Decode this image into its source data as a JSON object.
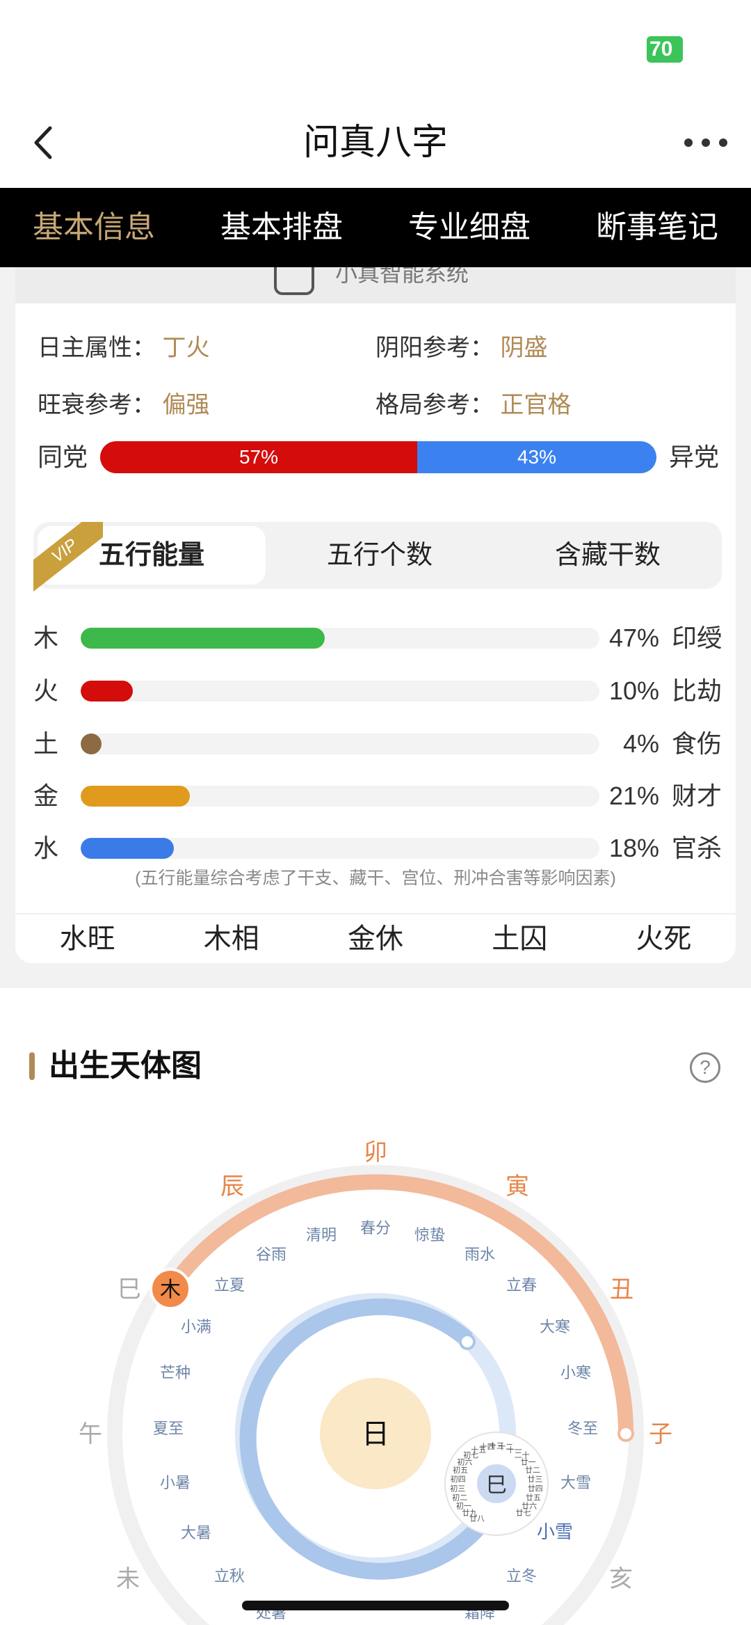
{
  "status": {
    "battery": "70"
  },
  "header": {
    "title": "问真八字"
  },
  "tabs": [
    "基本信息",
    "基本排盘",
    "专业细盘",
    "断事笔记"
  ],
  "strip_text": "小真智能系统",
  "info": {
    "day_master_label": "日主属性：",
    "day_master_value": "丁火",
    "yinyang_label": "阴阳参考：",
    "yinyang_value": "阴盛",
    "strength_label": "旺衰参考：",
    "strength_value": "偏强",
    "pattern_label": "格局参考：",
    "pattern_value": "正官格"
  },
  "party": {
    "left": "同党",
    "right": "异党",
    "same_pct": "57%",
    "diff_pct": "43%",
    "same": 57,
    "diff": 43,
    "same_color": "#d40c0c",
    "diff_color": "#3b82f0"
  },
  "segments": {
    "vip": "VIP",
    "items": [
      "五行能量",
      "五行个数",
      "含藏干数"
    ]
  },
  "elements": [
    {
      "name": "木",
      "pct": "47%",
      "value": 47,
      "god": "印绶",
      "color": "#3db84a"
    },
    {
      "name": "火",
      "pct": "10%",
      "value": 10,
      "god": "比劫",
      "color": "#d40c0c"
    },
    {
      "name": "土",
      "pct": "4%",
      "value": 4,
      "god": "食伤",
      "color": "#8b6a44"
    },
    {
      "name": "金",
      "pct": "21%",
      "value": 21,
      "god": "财才",
      "color": "#e09a1e"
    },
    {
      "name": "水",
      "pct": "18%",
      "value": 18,
      "god": "官杀",
      "color": "#3b7be8"
    }
  ],
  "note": "(五行能量综合考虑了干支、藏干、宫位、刑冲合害等影响因素)",
  "seasons": [
    "水旺",
    "木相",
    "金休",
    "土囚",
    "火死"
  ],
  "section": {
    "title": "出生天体图",
    "help": "?"
  },
  "sky_chart": {
    "branches": [
      "卯",
      "辰",
      "寅",
      "巳",
      "丑",
      "午",
      "子",
      "未",
      "亥"
    ],
    "terms": [
      "春分",
      "清明",
      "惊蛰",
      "谷雨",
      "雨水",
      "立夏",
      "立春",
      "小满",
      "大寒",
      "芒种",
      "小寒",
      "夏至",
      "冬至",
      "小暑",
      "大雪",
      "大暑",
      "小雪",
      "立秋",
      "立冬",
      "处暑",
      "霜降"
    ],
    "center": "日",
    "planet": "木",
    "moon": "巳",
    "lunar_days": [
      "廿八",
      "廿九",
      "初一",
      "初二",
      "初三",
      "初四",
      "初五",
      "初六",
      "初七",
      "十五",
      "十四",
      "十三",
      "十二",
      "十一",
      "二十",
      "廿一",
      "廿二",
      "廿三",
      "廿四",
      "廿五",
      "廿六",
      "廿七"
    ]
  }
}
